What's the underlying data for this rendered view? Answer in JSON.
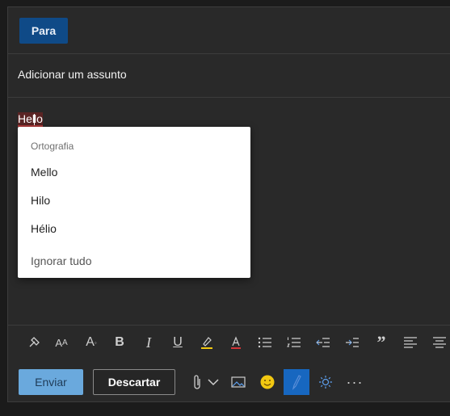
{
  "to": {
    "button_label": "Para"
  },
  "subject": {
    "placeholder": "Adicionar um assunto"
  },
  "body": {
    "text_before_caret": "Hel",
    "text_after_caret": "lo"
  },
  "spell_menu": {
    "header": "Ortografia",
    "suggestions": [
      "Mello",
      "Hilo",
      "Hélio"
    ],
    "ignore_all": "Ignorar tudo"
  },
  "format_toolbar": {
    "icons": [
      "format-painter-icon",
      "font-size-icon",
      "increase-font-size-icon",
      "bold-icon",
      "italic-icon",
      "underline-icon",
      "highlight-icon",
      "font-color-icon",
      "bullets-icon",
      "numbering-icon",
      "decrease-indent-icon",
      "increase-indent-icon",
      "quote-icon",
      "align-left-icon",
      "align-center-icon"
    ]
  },
  "actions": {
    "send_label": "Enviar",
    "discard_label": "Descartar",
    "icons": [
      "attach-icon",
      "chevron-down-icon",
      "insert-picture-icon",
      "emoji-icon",
      "signature-icon",
      "brightness-icon",
      "more-icon"
    ]
  },
  "colors": {
    "para_button": "#0f4a87",
    "send_button": "#6aa9dd",
    "active_tool": "#1767c0"
  }
}
